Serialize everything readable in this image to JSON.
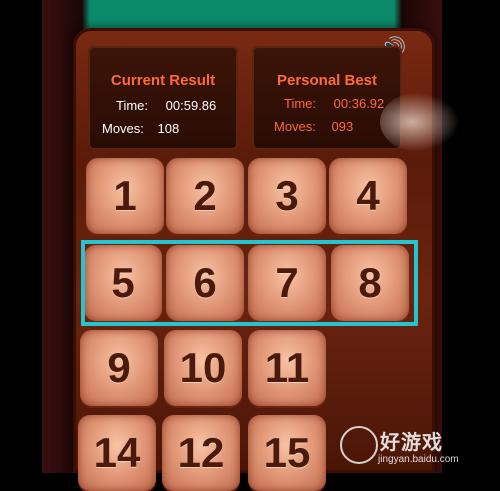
{
  "header": {
    "home_icon": "home-icon",
    "sound_icon": "speaker-icon"
  },
  "current": {
    "title": "Current Result",
    "time_label": "Time:",
    "time_value": "00:59.86",
    "moves_label": "Moves:",
    "moves_value": "108"
  },
  "best": {
    "title": "Personal Best",
    "time_label": "Time:",
    "time_value": "00:36.92",
    "moves_label": "Moves:",
    "moves_value": "093"
  },
  "tiles": [
    "1",
    "2",
    "3",
    "4",
    "5",
    "6",
    "7",
    "8",
    "9",
    "10",
    "11",
    "14",
    "12",
    "15"
  ],
  "watermark": {
    "text": "好游戏",
    "url": "jingyan.baidu.com"
  },
  "colors": {
    "accent": "#ff6a3a",
    "highlight": "#23c6cf",
    "background": "#0b8a6a"
  }
}
